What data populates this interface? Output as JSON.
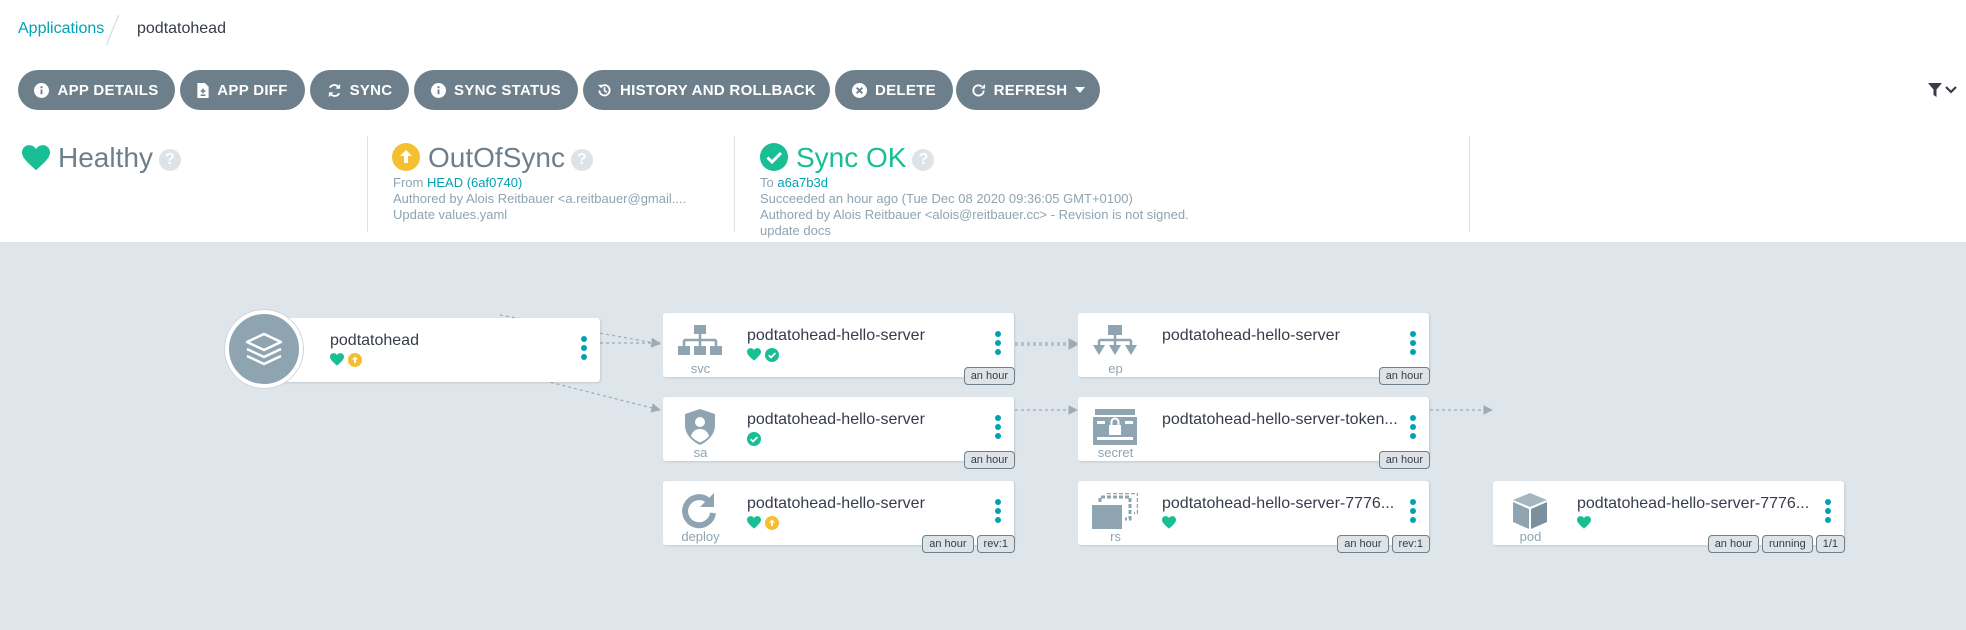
{
  "breadcrumb": {
    "root": "Applications",
    "current": "podtatohead"
  },
  "toolbar": {
    "app_details": "APP DETAILS",
    "app_diff": "APP DIFF",
    "sync": "SYNC",
    "sync_status": "SYNC STATUS",
    "history": "HISTORY AND ROLLBACK",
    "delete": "DELETE",
    "refresh": "REFRESH"
  },
  "health": {
    "status": "Healthy",
    "help": "?"
  },
  "sync": {
    "status": "OutOfSync",
    "help": "?",
    "from_label": "From",
    "from_rev": "HEAD (6af0740)",
    "author": "Authored by Alois Reitbauer <a.reitbauer@gmail....",
    "message": "Update values.yaml"
  },
  "operation": {
    "status": "Sync OK",
    "help": "?",
    "to_label": "To",
    "to_rev": "a6a7b3d",
    "succeeded": "Succeeded an hour ago (Tue Dec 08 2020 09:36:05 GMT+0100)",
    "author": "Authored by Alois Reitbauer <alois@reitbauer.cc> - Revision is not signed.",
    "message": "update docs"
  },
  "tree": {
    "app": {
      "name": "podtatohead"
    },
    "nodes": [
      {
        "name": "podtatohead-hello-server",
        "kind": "svc",
        "tags": [
          "an hour"
        ]
      },
      {
        "name": "podtatohead-hello-server",
        "kind": "sa",
        "tags": [
          "an hour"
        ]
      },
      {
        "name": "podtatohead-hello-server",
        "kind": "deploy",
        "tags": [
          "an hour",
          "rev:1"
        ]
      },
      {
        "name": "podtatohead-hello-server",
        "kind": "ep",
        "tags": [
          "an hour"
        ]
      },
      {
        "name": "podtatohead-hello-server-token...",
        "kind": "secret",
        "tags": [
          "an hour"
        ]
      },
      {
        "name": "podtatohead-hello-server-7776...",
        "kind": "rs",
        "tags": [
          "an hour",
          "rev:1"
        ]
      },
      {
        "name": "podtatohead-hello-server-7776...",
        "kind": "pod",
        "tags": [
          "an hour",
          "running",
          "1/1"
        ]
      }
    ]
  },
  "colors": {
    "accent": "#00a2b3",
    "healthy": "#18be94",
    "outofsync": "#f4c030",
    "button": "#6d7f8b",
    "canvas": "#dee6eb"
  }
}
